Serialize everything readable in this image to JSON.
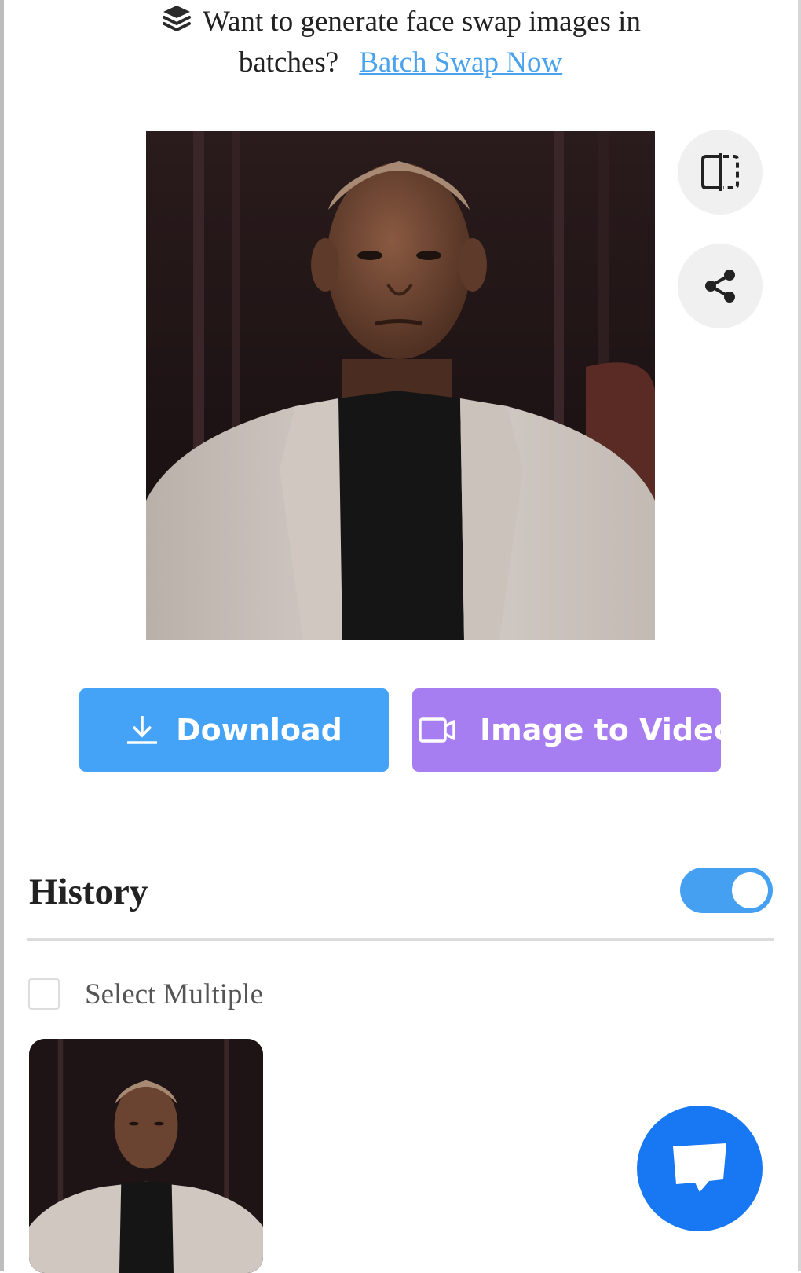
{
  "banner": {
    "line1": "Want to generate face swap images in",
    "line2": "batches?",
    "link": "Batch Swap Now"
  },
  "result": {
    "image": "face-swap-result-portrait",
    "compare_icon": "compare-icon",
    "share_icon": "share-icon"
  },
  "actions": {
    "download_label": "Download",
    "download_icon": "download-icon",
    "video_label": "Image to Video",
    "video_icon": "video-camera-icon"
  },
  "history": {
    "title": "History",
    "toggle_on": true,
    "select_multiple_label": "Select Multiple",
    "select_multiple_checked": false,
    "items": [
      {
        "thumbnail": "face-swap-result-portrait"
      }
    ]
  },
  "chat": {
    "icon": "chat-icon"
  },
  "colors": {
    "download_button": "#45a3f7",
    "video_button": "#a77ef2",
    "link": "#4aa3ec",
    "toggle": "#45a0f2",
    "chat_button": "#1877f2"
  }
}
